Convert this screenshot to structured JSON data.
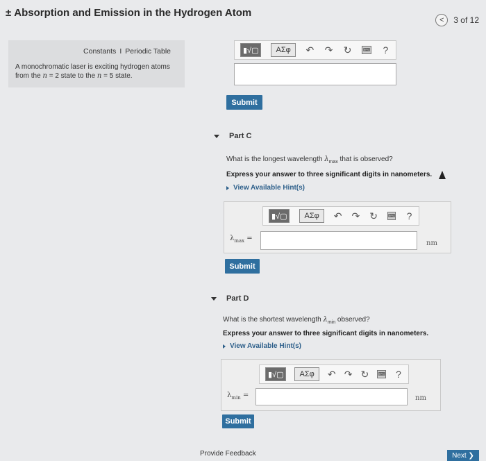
{
  "header": {
    "title_symbol": "±",
    "title": "Absorption and Emission in the Hydrogen Atom",
    "prev_icon": "chevron-left-icon",
    "page_indicator": "3 of 12"
  },
  "left_panel": {
    "constants_link": "Constants",
    "separator": "I",
    "periodic_table_link": "Periodic Table",
    "desc_line1": "A monochromatic laser is exciting hydrogen atoms",
    "desc_line2_a": "from the ",
    "desc_n1": "n",
    "desc_eq1": " = 2 state to the ",
    "desc_n2": "n",
    "desc_eq2": " = 5 state."
  },
  "toolbar": {
    "templates_label": "▮√▢",
    "greek_label": "ΑΣφ",
    "undo_icon": "↶",
    "redo_icon": "↷",
    "reset_icon": "↻",
    "keyboard_label": "⌨",
    "help_label": "?"
  },
  "part_b": {
    "submit_label": "Submit"
  },
  "part_c": {
    "heading": "Part C",
    "question_a": "What is the longest wavelength ",
    "var_symbol": "λ",
    "var_sub": "max",
    "question_b": " that is observed?",
    "instruction": "Express your answer to three significant digits in nanometers.",
    "hint": "View Available Hint(s)",
    "label_eq": " =",
    "unit": "nm",
    "submit_label": "Submit"
  },
  "part_d": {
    "heading": "Part D",
    "question_a": "What is the shortest wavelength ",
    "var_symbol": "λ",
    "var_sub": "min",
    "question_b": " observed?",
    "instruction": "Express your answer to three significant digits in nanometers.",
    "hint": "View Available Hint(s)",
    "label_eq": " =",
    "unit": "nm",
    "submit_label": "Submit"
  },
  "footer": {
    "feedback": "Provide Feedback",
    "next": "Next ❯"
  }
}
